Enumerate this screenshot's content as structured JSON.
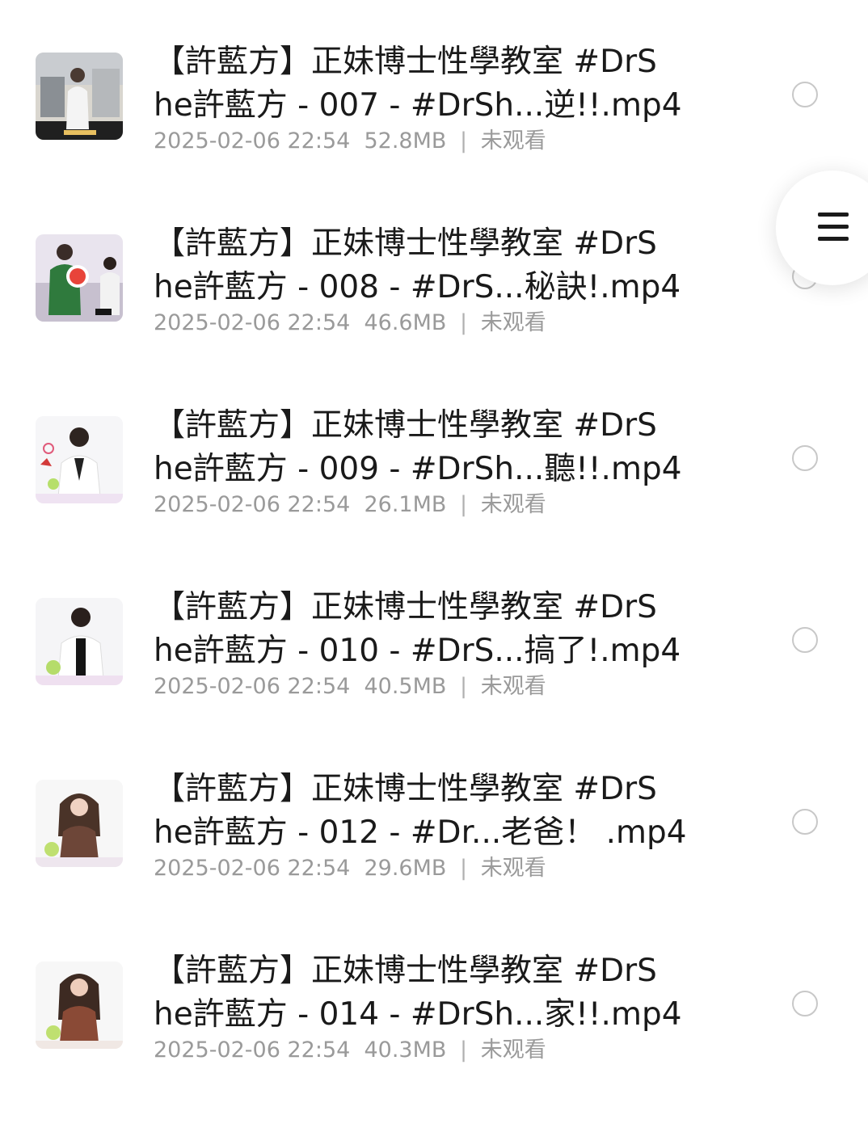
{
  "files": [
    {
      "title_line1": "【許藍方】正妹博士性學教室 #DrS",
      "title_line2": "he許藍方 - 007 - #DrSh...逆!!.mp4",
      "date": "2025-02-06 22:54",
      "size": "52.8MB",
      "separator": "|",
      "status": "未观看"
    },
    {
      "title_line1": "【許藍方】正妹博士性學教室 #DrS",
      "title_line2": "he許藍方 - 008 - #DrS...秘訣!.mp4",
      "date": "2025-02-06 22:54",
      "size": "46.6MB",
      "separator": "|",
      "status": "未观看"
    },
    {
      "title_line1": "【許藍方】正妹博士性學教室 #DrS",
      "title_line2": "he許藍方 - 009 - #DrSh...聽!!.mp4",
      "date": "2025-02-06 22:54",
      "size": "26.1MB",
      "separator": "|",
      "status": "未观看"
    },
    {
      "title_line1": "【許藍方】正妹博士性學教室 #DrS",
      "title_line2": "he許藍方 - 010 - #DrS...搞了!.mp4",
      "date": "2025-02-06 22:54",
      "size": "40.5MB",
      "separator": "|",
      "status": "未观看"
    },
    {
      "title_line1": "【許藍方】正妹博士性學教室 #DrS",
      "title_line2": "he許藍方 - 012 - #Dr...老爸！ .mp4",
      "date": "2025-02-06 22:54",
      "size": "29.6MB",
      "separator": "|",
      "status": "未观看"
    },
    {
      "title_line1": "【許藍方】正妹博士性學教室 #DrS",
      "title_line2": "he許藍方 - 014 - #DrSh...家!!.mp4",
      "date": "2025-02-06 22:54",
      "size": "40.3MB",
      "separator": "|",
      "status": "未观看"
    }
  ],
  "floating_menu": {
    "icon": "menu-icon"
  },
  "colors": {
    "title": "#1a1a1a",
    "meta": "#9a9a9a",
    "radio_border": "#c8c8c8",
    "background": "#ffffff"
  }
}
